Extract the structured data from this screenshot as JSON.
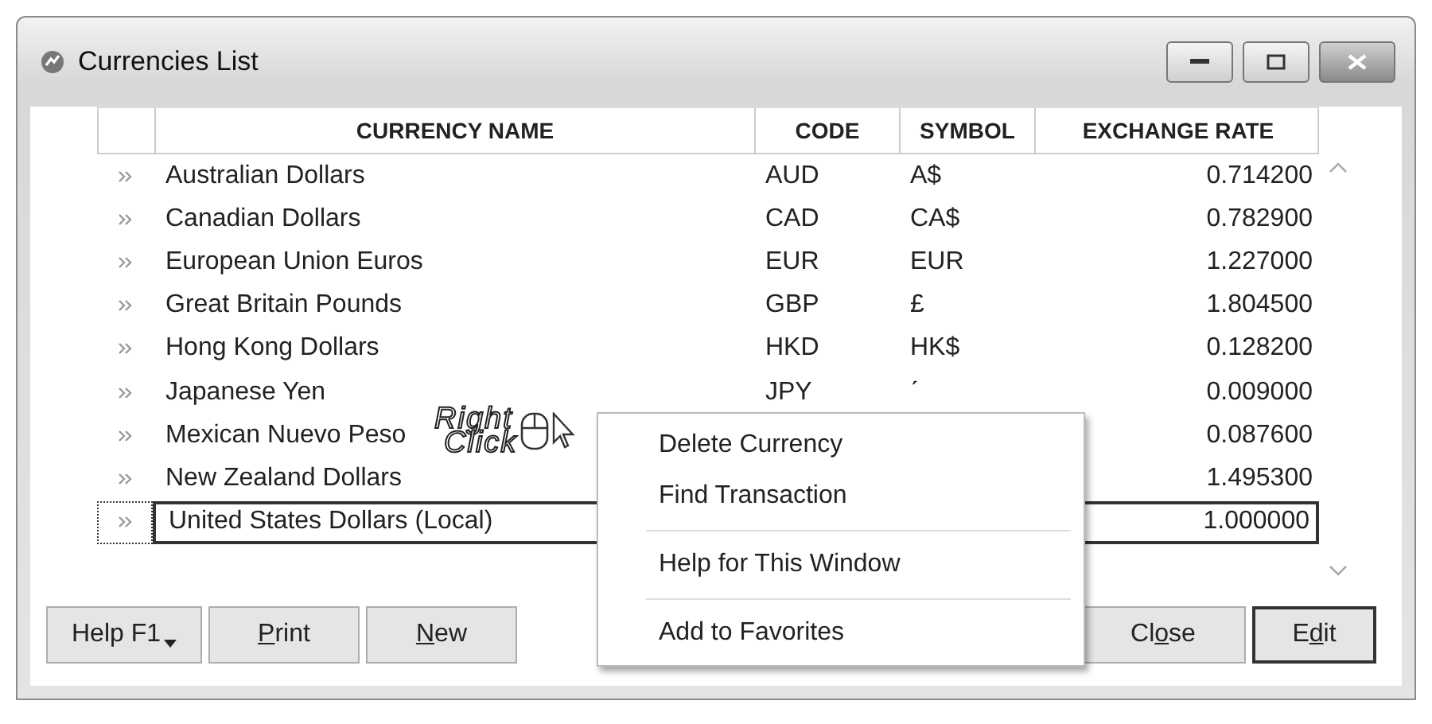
{
  "window": {
    "title": "Currencies List"
  },
  "table": {
    "columns": [
      "CURRENCY NAME",
      "CODE",
      "SYMBOL",
      "EXCHANGE RATE"
    ],
    "rows": [
      {
        "name": "Australian Dollars",
        "code": "AUD",
        "symbol": "A$",
        "rate": "0.714200",
        "selected": false
      },
      {
        "name": "Canadian Dollars",
        "code": "CAD",
        "symbol": "CA$",
        "rate": "0.782900",
        "selected": false
      },
      {
        "name": "European Union Euros",
        "code": "EUR",
        "symbol": "EUR",
        "rate": "1.227000",
        "selected": false
      },
      {
        "name": "Great Britain Pounds",
        "code": "GBP",
        "symbol": "£",
        "rate": "1.804500",
        "selected": false
      },
      {
        "name": "Hong Kong Dollars",
        "code": "HKD",
        "symbol": "HK$",
        "rate": "0.128200",
        "selected": false
      },
      {
        "name": "Japanese Yen",
        "code": "JPY",
        "symbol": "ˊ",
        "rate": "0.009000",
        "selected": false
      },
      {
        "name": "Mexican Nuevo Peso",
        "rate": "0.087600",
        "selected": false
      },
      {
        "name": "New Zealand Dollars",
        "rate": "1.495300",
        "selected": false
      },
      {
        "name": "United States Dollars (Local)",
        "rate": "1.000000",
        "selected": true
      }
    ]
  },
  "annotation": {
    "line1": "Right",
    "line2": "Click"
  },
  "context_menu": [
    {
      "label": "Delete Currency",
      "separator_after": false
    },
    {
      "label": "Find Transaction",
      "separator_after": true
    },
    {
      "label": "Help for This Window",
      "separator_after": true
    },
    {
      "label": "Add to Favorites",
      "separator_after": false
    }
  ],
  "buttons": [
    {
      "kind": "dropdown",
      "before": "Help F1",
      "default": false
    },
    {
      "kind": "plain",
      "key": "P",
      "after": "rint",
      "default": false
    },
    {
      "kind": "plain",
      "key": "N",
      "after": "ew",
      "default": false
    },
    {
      "kind": "spacer"
    },
    {
      "kind": "plain",
      "before": "Cl",
      "key": "o",
      "after": "se",
      "default": false
    },
    {
      "kind": "plain",
      "before": "E",
      "key": "d",
      "after": "it",
      "default": true
    }
  ]
}
